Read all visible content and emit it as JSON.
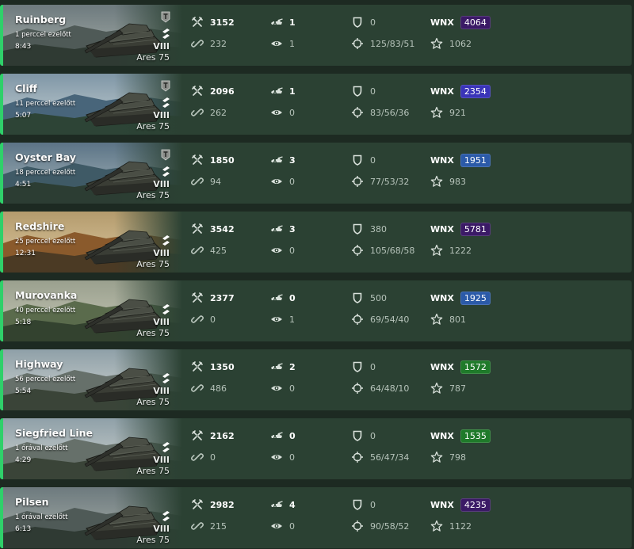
{
  "colors": {
    "row_bg": "#2b4133",
    "win_bar": "#2fd06a",
    "wnx_purple": "#3b1a66",
    "wnx_indigo": "#3a34b8",
    "wnx_blue": "#2b5aa8",
    "wnx_green": "#1f7a2a"
  },
  "icons": {
    "damage": "crossed-swords-icon",
    "assist": "link-icon",
    "frags": "tank-kill-icon",
    "spotted": "eye-icon",
    "blocked": "shield-icon",
    "hits": "crosshair-icon",
    "xp": "star-icon",
    "mastery": "mastery-badge-icon",
    "rank": "chevron-rank-icon"
  },
  "wnx_label": "WNX",
  "battles": [
    {
      "map": "Ruinberg",
      "ago": "1 perccel ezelőtt",
      "duration": "8:43",
      "tier": "VIII",
      "tank": "Ares 75",
      "damage": "3152",
      "assist": "232",
      "frags": "1",
      "spotted": "1",
      "blocked": "0",
      "hits": "125/83/51",
      "wnx": "4064",
      "wnx_color": "#3b1a66",
      "xp": "1062",
      "mastery": true,
      "scene": "city"
    },
    {
      "map": "Cliff",
      "ago": "11 perccel ezelőtt",
      "duration": "5:07",
      "tier": "VIII",
      "tank": "Ares 75",
      "damage": "2096",
      "assist": "262",
      "frags": "1",
      "spotted": "0",
      "blocked": "0",
      "hits": "83/56/36",
      "wnx": "2354",
      "wnx_color": "#3a34b8",
      "xp": "921",
      "mastery": true,
      "scene": "sea"
    },
    {
      "map": "Oyster Bay",
      "ago": "18 perccel ezelőtt",
      "duration": "4:51",
      "tier": "VIII",
      "tank": "Ares 75",
      "damage": "1850",
      "assist": "94",
      "frags": "3",
      "spotted": "0",
      "blocked": "0",
      "hits": "77/53/32",
      "wnx": "1951",
      "wnx_color": "#2b5aa8",
      "xp": "983",
      "mastery": true,
      "scene": "bay"
    },
    {
      "map": "Redshire",
      "ago": "25 perccel ezelőtt",
      "duration": "12:31",
      "tier": "VIII",
      "tank": "Ares 75",
      "damage": "3542",
      "assist": "425",
      "frags": "3",
      "spotted": "0",
      "blocked": "380",
      "hits": "105/68/58",
      "wnx": "5781",
      "wnx_color": "#3b1a66",
      "xp": "1222",
      "mastery": false,
      "scene": "autumn"
    },
    {
      "map": "Murovanka",
      "ago": "40 perccel ezelőtt",
      "duration": "5:18",
      "tier": "VIII",
      "tank": "Ares 75",
      "damage": "2377",
      "assist": "0",
      "frags": "0",
      "spotted": "1",
      "blocked": "500",
      "hits": "69/54/40",
      "wnx": "1925",
      "wnx_color": "#2b5aa8",
      "xp": "801",
      "mastery": false,
      "scene": "forest"
    },
    {
      "map": "Highway",
      "ago": "56 perccel ezelőtt",
      "duration": "5:54",
      "tier": "VIII",
      "tank": "Ares 75",
      "damage": "1350",
      "assist": "486",
      "frags": "2",
      "spotted": "0",
      "blocked": "0",
      "hits": "64/48/10",
      "wnx": "1572",
      "wnx_color": "#1f7a2a",
      "xp": "787",
      "mastery": false,
      "scene": "town"
    },
    {
      "map": "Siegfried Line",
      "ago": "1 órával ezelőtt",
      "duration": "4:29",
      "tier": "VIII",
      "tank": "Ares 75",
      "damage": "2162",
      "assist": "0",
      "frags": "0",
      "spotted": "0",
      "blocked": "0",
      "hits": "56/47/34",
      "wnx": "1535",
      "wnx_color": "#1f7a2a",
      "xp": "798",
      "mastery": false,
      "scene": "town"
    },
    {
      "map": "Pilsen",
      "ago": "1 órával ezelőtt",
      "duration": "6:13",
      "tier": "VIII",
      "tank": "Ares 75",
      "damage": "2982",
      "assist": "215",
      "frags": "4",
      "spotted": "0",
      "blocked": "0",
      "hits": "90/58/52",
      "wnx": "4235",
      "wnx_color": "#3b1a66",
      "xp": "1122",
      "mastery": false,
      "scene": "city"
    }
  ]
}
